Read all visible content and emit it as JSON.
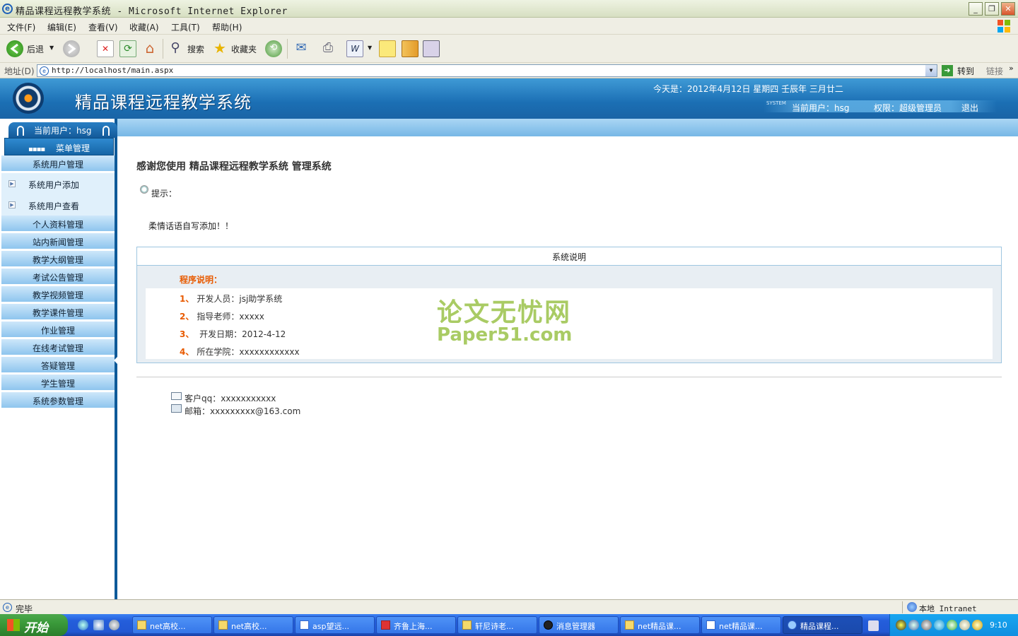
{
  "window": {
    "title": "精品课程远程教学系统 - Microsoft Internet Explorer"
  },
  "menubar": [
    "文件(F)",
    "编辑(E)",
    "查看(V)",
    "收藏(A)",
    "工具(T)",
    "帮助(H)"
  ],
  "toolbar": {
    "back": "后退",
    "search": "搜索",
    "favorites": "收藏夹"
  },
  "address": {
    "label": "地址(D)",
    "url": "http://localhost/main.aspx",
    "go": "转到",
    "links": "链接"
  },
  "header": {
    "system_name": "精品课程远程教学系统",
    "date": "今天是：2012年4月12日 星期四 壬辰年 三月廿二",
    "system_tag": "SYSTEM",
    "current_user": "当前用户：hsg",
    "permission": "权限：超级管理员",
    "logout": "退出"
  },
  "sidebar": {
    "current_user": "当前用户：hsg",
    "menu_title": "菜单管理",
    "group_user": "系统用户管理",
    "sub_add": "系统用户添加",
    "sub_view": "系统用户查看",
    "groups": [
      "个人资料管理",
      "站内新闻管理",
      "教学大纲管理",
      "考试公告管理",
      "教学视频管理",
      "教学课件管理",
      "作业管理",
      "在线考试管理",
      "答疑管理",
      "学生管理",
      "系统参数管理"
    ]
  },
  "main": {
    "welcome": "感谢您使用 精品课程远程教学系统 管理系统",
    "tip_label": "提示：",
    "tip_text": "柔情话语自写添加！！",
    "explain_title": "系统说明",
    "program_title": "程序说明：",
    "info": [
      {
        "num": "1、",
        "text": "开发人员：jsj助学系统"
      },
      {
        "num": "2、",
        "text": "指导老师：xxxxx"
      },
      {
        "num": "3、",
        "text": " 开发日期：2012-4-12"
      },
      {
        "num": "4、",
        "text": "所在学院：xxxxxxxxxxxx"
      }
    ],
    "watermark_cn": "论文无忧网",
    "watermark_en": "Paper51.com",
    "qq": "客户qq：xxxxxxxxxxx",
    "email": "邮箱：xxxxxxxxx@163.com"
  },
  "status": {
    "text": "完毕",
    "zone": "本地 Intranet"
  },
  "taskbar": {
    "start": "开始",
    "items": [
      "net高校...",
      "net高校...",
      "asp望远...",
      "齐鲁上海...",
      "轩尼诗老...",
      "消息管理器",
      "net精品课...",
      "net精品课...",
      "精品课程..."
    ],
    "clock": "9:10"
  }
}
